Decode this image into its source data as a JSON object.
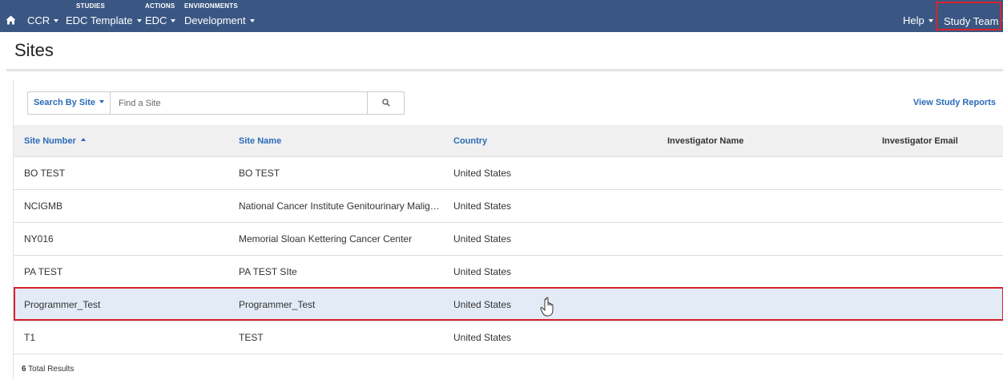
{
  "nav": {
    "home_icon": "home-icon",
    "items": [
      {
        "caption": "",
        "label": "CCR"
      },
      {
        "caption": "STUDIES",
        "label": "EDC Template"
      },
      {
        "caption": "ACTIONS",
        "label": "EDC"
      },
      {
        "caption": "ENVIRONMENTS",
        "label": "Development"
      }
    ],
    "help": "Help",
    "study_team": "Study Team"
  },
  "page": {
    "title": "Sites"
  },
  "search": {
    "by_label": "Search By Site",
    "placeholder": "Find a Site",
    "search_icon": "search-icon"
  },
  "links": {
    "view_reports": "View Study Reports"
  },
  "table": {
    "columns": [
      "Site Number",
      "Site Name",
      "Country",
      "Investigator Name",
      "Investigator Email"
    ],
    "sorted_column": "Site Number",
    "sort_direction": "ascending",
    "rows": [
      {
        "number": "BO TEST",
        "name": "BO TEST",
        "country": "United States",
        "investigator": "",
        "email": ""
      },
      {
        "number": "NCIGMB",
        "name": "National Cancer Institute Genitourinary Malignan...",
        "country": "United States",
        "investigator": "",
        "email": ""
      },
      {
        "number": "NY016",
        "name": "Memorial Sloan Kettering Cancer Center",
        "country": "United States",
        "investigator": "",
        "email": ""
      },
      {
        "number": "PA TEST",
        "name": "PA TEST SIte",
        "country": "United States",
        "investigator": "",
        "email": ""
      },
      {
        "number": "Programmer_Test",
        "name": "Programmer_Test",
        "country": "United States",
        "investigator": "",
        "email": ""
      },
      {
        "number": "T1",
        "name": "TEST",
        "country": "United States",
        "investigator": "",
        "email": ""
      }
    ],
    "selected_row": "Programmer_Test"
  },
  "footer": {
    "total_count": "6",
    "total_label": "Total Results"
  },
  "colors": {
    "nav_bg": "#3a5783",
    "link": "#2a6bb8",
    "highlight": "#d6242c",
    "selected_row": "#e3ebf6"
  }
}
